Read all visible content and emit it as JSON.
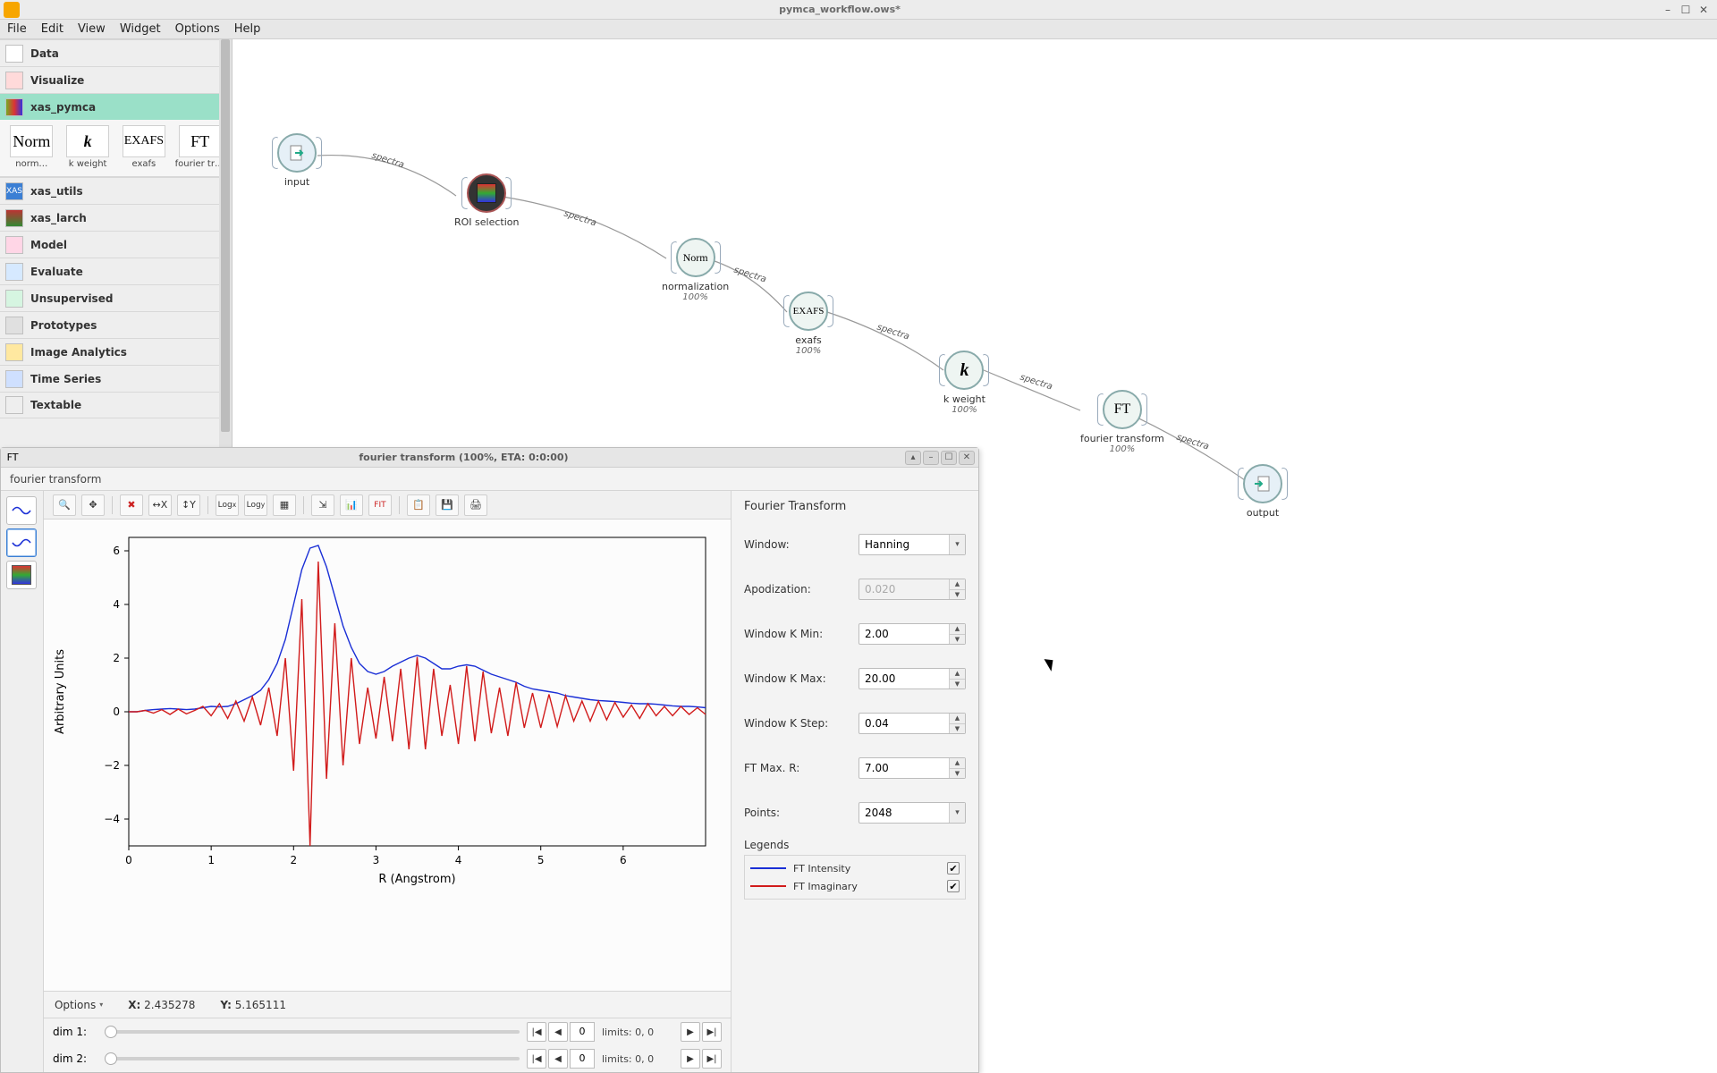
{
  "window_title": "pymca_workflow.ows*",
  "menubar": [
    "File",
    "Edit",
    "View",
    "Widget",
    "Options",
    "Help"
  ],
  "toolbox": {
    "categories": [
      {
        "label": "Data"
      },
      {
        "label": "Visualize"
      },
      {
        "label": "xas_pymca",
        "selected": true
      },
      {
        "label": "xas_utils",
        "badge": "XAS"
      },
      {
        "label": "xas_larch"
      },
      {
        "label": "Model"
      },
      {
        "label": "Evaluate"
      },
      {
        "label": "Unsupervised"
      },
      {
        "label": "Prototypes"
      },
      {
        "label": "Image Analytics"
      },
      {
        "label": "Time Series"
      },
      {
        "label": "Textable"
      }
    ],
    "widgets": [
      {
        "icon_text": "Norm",
        "label": "norm…"
      },
      {
        "icon_text": "k",
        "label": "k weight"
      },
      {
        "icon_text": "EXAFS",
        "label": "exafs"
      },
      {
        "icon_text": "FT",
        "label": "fourier transf…"
      }
    ]
  },
  "canvas": {
    "link_text": "spectra",
    "nodes": {
      "input": {
        "label": "input"
      },
      "roi": {
        "label": "ROI selection"
      },
      "norm": {
        "label": "normalization",
        "sub": "100%",
        "icon": "Norm"
      },
      "exafs": {
        "label": "exafs",
        "sub": "100%",
        "icon": "EXAFS"
      },
      "kweight": {
        "label": "k weight",
        "sub": "100%",
        "icon": "k"
      },
      "ft": {
        "label": "fourier transform",
        "sub": "100%",
        "icon": "FT"
      },
      "output": {
        "label": "output"
      }
    }
  },
  "dialog": {
    "tag": "FT",
    "title": "fourier transform (100%, ETA: 0:0:00)",
    "subtitle": "fourier transform",
    "plot_toolbar_tips": [
      "zoom",
      "pan",
      "reset",
      "fit-x",
      "fit-y",
      "log-x",
      "log-y",
      "grid",
      "toggle-axes",
      "stats",
      "fit",
      "export",
      "save",
      "print"
    ],
    "plot_footer": {
      "options": "Options",
      "x_label": "X:",
      "x_val": "2.435278",
      "y_label": "Y:",
      "y_val": "5.165111"
    },
    "dims": [
      {
        "label": "dim 1:",
        "value": "0",
        "limits": "limits: 0, 0"
      },
      {
        "label": "dim 2:",
        "value": "0",
        "limits": "limits: 0, 0"
      }
    ],
    "params_title": "Fourier Transform",
    "params": [
      {
        "label": "Window:",
        "type": "select",
        "value": "Hanning"
      },
      {
        "label": "Apodization:",
        "type": "spin",
        "value": "0.020",
        "disabled": true
      },
      {
        "label": "Window K Min:",
        "type": "spin",
        "value": "2.00"
      },
      {
        "label": "Window K Max:",
        "type": "spin",
        "value": "20.00"
      },
      {
        "label": "Window K Step:",
        "type": "spin",
        "value": "0.04"
      },
      {
        "label": "FT Max. R:",
        "type": "spin",
        "value": "7.00"
      },
      {
        "label": "Points:",
        "type": "select",
        "value": "2048"
      }
    ],
    "legends_title": "Legends",
    "legends": [
      {
        "name": "FT Intensity",
        "color": "#1a2fd6",
        "checked": true
      },
      {
        "name": "FT Imaginary",
        "color": "#d11b1b",
        "checked": true
      }
    ]
  },
  "chart_data": {
    "type": "line",
    "title": "",
    "xlabel": "R (Angstrom)",
    "ylabel": "Arbitrary Units",
    "xlim": [
      0,
      7
    ],
    "ylim": [
      -5,
      6.5
    ],
    "xticks": [
      0,
      1,
      2,
      3,
      4,
      5,
      6
    ],
    "yticks": [
      -4,
      -2,
      0,
      2,
      4,
      6
    ],
    "x": [
      0.0,
      0.1,
      0.2,
      0.3,
      0.4,
      0.5,
      0.6,
      0.7,
      0.8,
      0.9,
      1.0,
      1.1,
      1.2,
      1.3,
      1.4,
      1.5,
      1.6,
      1.7,
      1.8,
      1.9,
      2.0,
      2.1,
      2.2,
      2.3,
      2.4,
      2.5,
      2.6,
      2.7,
      2.8,
      2.9,
      3.0,
      3.1,
      3.2,
      3.3,
      3.4,
      3.5,
      3.6,
      3.7,
      3.8,
      3.9,
      4.0,
      4.1,
      4.2,
      4.3,
      4.4,
      4.5,
      4.6,
      4.7,
      4.8,
      4.9,
      5.0,
      5.1,
      5.2,
      5.3,
      5.4,
      5.5,
      5.6,
      5.7,
      5.8,
      5.9,
      6.0,
      6.1,
      6.2,
      6.3,
      6.4,
      6.5,
      6.6,
      6.7,
      6.8,
      6.9,
      7.0
    ],
    "series": [
      {
        "name": "FT Intensity",
        "color": "#1a2fd6",
        "y": [
          0.0,
          0.0,
          0.05,
          0.08,
          0.1,
          0.12,
          0.1,
          0.08,
          0.1,
          0.15,
          0.2,
          0.18,
          0.2,
          0.3,
          0.45,
          0.6,
          0.8,
          1.2,
          1.8,
          2.7,
          4.0,
          5.3,
          6.1,
          6.2,
          5.4,
          4.3,
          3.2,
          2.4,
          1.8,
          1.5,
          1.4,
          1.5,
          1.7,
          1.85,
          2.0,
          2.1,
          2.0,
          1.8,
          1.6,
          1.6,
          1.7,
          1.75,
          1.7,
          1.55,
          1.4,
          1.3,
          1.2,
          1.1,
          0.95,
          0.85,
          0.8,
          0.75,
          0.7,
          0.6,
          0.55,
          0.5,
          0.45,
          0.42,
          0.4,
          0.38,
          0.35,
          0.32,
          0.3,
          0.3,
          0.28,
          0.25,
          0.22,
          0.2,
          0.2,
          0.18,
          0.15
        ]
      },
      {
        "name": "FT Imaginary",
        "color": "#d11b1b",
        "y": [
          0.0,
          0.0,
          0.05,
          -0.05,
          0.08,
          -0.1,
          0.1,
          -0.08,
          0.05,
          0.2,
          -0.15,
          0.3,
          -0.25,
          0.4,
          -0.35,
          0.55,
          -0.5,
          0.9,
          -0.9,
          2.0,
          -2.2,
          4.2,
          -5.0,
          5.6,
          -2.5,
          3.3,
          -2.0,
          2.0,
          -1.2,
          0.9,
          -1.0,
          1.3,
          -1.1,
          1.6,
          -1.4,
          2.05,
          -1.4,
          1.6,
          -0.9,
          1.0,
          -1.2,
          1.7,
          -1.1,
          1.5,
          -0.8,
          0.9,
          -0.9,
          1.1,
          -0.6,
          0.7,
          -0.6,
          0.65,
          -0.55,
          0.6,
          -0.35,
          0.4,
          -0.35,
          0.4,
          -0.3,
          0.35,
          -0.2,
          0.25,
          -0.25,
          0.3,
          -0.15,
          0.2,
          -0.15,
          0.2,
          -0.1,
          0.15,
          -0.1
        ]
      }
    ]
  }
}
